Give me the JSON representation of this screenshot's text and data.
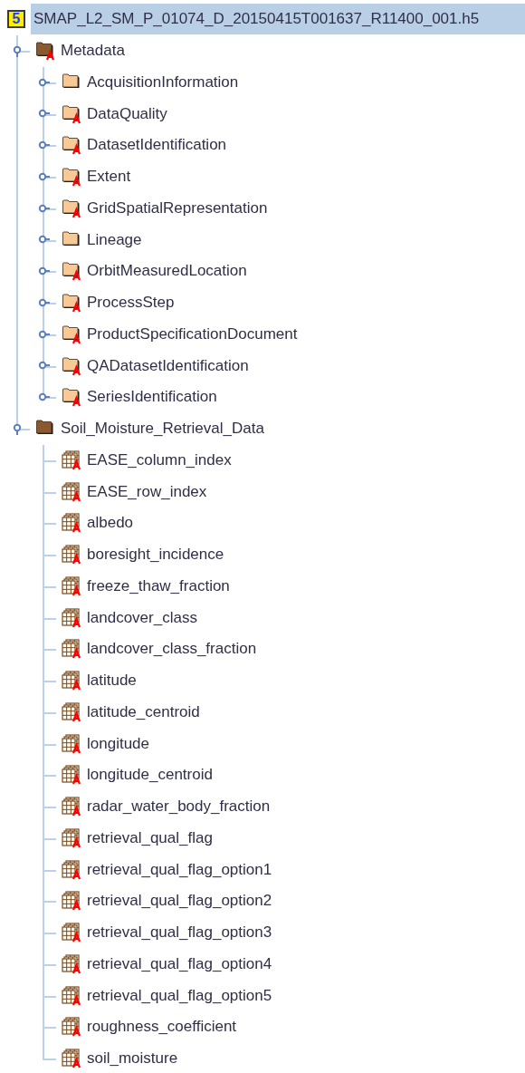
{
  "tree": {
    "label": "SMAP_L2_SM_P_01074_D_20150415T001637_R11400_001.h5",
    "file_icon_text": "5",
    "selected": true,
    "children": [
      {
        "kind": "group",
        "label": "Metadata",
        "expanded": true,
        "has_attributes": true,
        "children": [
          {
            "kind": "group",
            "label": "AcquisitionInformation",
            "expanded": false,
            "has_attributes": false
          },
          {
            "kind": "group",
            "label": "DataQuality",
            "expanded": false,
            "has_attributes": true
          },
          {
            "kind": "group",
            "label": "DatasetIdentification",
            "expanded": false,
            "has_attributes": true
          },
          {
            "kind": "group",
            "label": "Extent",
            "expanded": false,
            "has_attributes": true
          },
          {
            "kind": "group",
            "label": "GridSpatialRepresentation",
            "expanded": false,
            "has_attributes": true
          },
          {
            "kind": "group",
            "label": "Lineage",
            "expanded": false,
            "has_attributes": false
          },
          {
            "kind": "group",
            "label": "OrbitMeasuredLocation",
            "expanded": false,
            "has_attributes": true
          },
          {
            "kind": "group",
            "label": "ProcessStep",
            "expanded": false,
            "has_attributes": true
          },
          {
            "kind": "group",
            "label": "ProductSpecificationDocument",
            "expanded": false,
            "has_attributes": true
          },
          {
            "kind": "group",
            "label": "QADatasetIdentification",
            "expanded": false,
            "has_attributes": true
          },
          {
            "kind": "group",
            "label": "SeriesIdentification",
            "expanded": false,
            "has_attributes": true
          }
        ]
      },
      {
        "kind": "group",
        "label": "Soil_Moisture_Retrieval_Data",
        "expanded": true,
        "has_attributes": false,
        "children": [
          {
            "kind": "dataset",
            "label": "EASE_column_index",
            "has_attributes": true
          },
          {
            "kind": "dataset",
            "label": "EASE_row_index",
            "has_attributes": true
          },
          {
            "kind": "dataset",
            "label": "albedo",
            "has_attributes": true
          },
          {
            "kind": "dataset",
            "label": "boresight_incidence",
            "has_attributes": true
          },
          {
            "kind": "dataset",
            "label": "freeze_thaw_fraction",
            "has_attributes": true
          },
          {
            "kind": "dataset",
            "label": "landcover_class",
            "has_attributes": true
          },
          {
            "kind": "dataset",
            "label": "landcover_class_fraction",
            "has_attributes": true
          },
          {
            "kind": "dataset",
            "label": "latitude",
            "has_attributes": true
          },
          {
            "kind": "dataset",
            "label": "latitude_centroid",
            "has_attributes": true
          },
          {
            "kind": "dataset",
            "label": "longitude",
            "has_attributes": true
          },
          {
            "kind": "dataset",
            "label": "longitude_centroid",
            "has_attributes": true
          },
          {
            "kind": "dataset",
            "label": "radar_water_body_fraction",
            "has_attributes": true
          },
          {
            "kind": "dataset",
            "label": "retrieval_qual_flag",
            "has_attributes": true
          },
          {
            "kind": "dataset",
            "label": "retrieval_qual_flag_option1",
            "has_attributes": true
          },
          {
            "kind": "dataset",
            "label": "retrieval_qual_flag_option2",
            "has_attributes": true
          },
          {
            "kind": "dataset",
            "label": "retrieval_qual_flag_option3",
            "has_attributes": true
          },
          {
            "kind": "dataset",
            "label": "retrieval_qual_flag_option4",
            "has_attributes": true
          },
          {
            "kind": "dataset",
            "label": "retrieval_qual_flag_option5",
            "has_attributes": true
          },
          {
            "kind": "dataset",
            "label": "roughness_coefficient",
            "has_attributes": true
          },
          {
            "kind": "dataset",
            "label": "soil_moisture",
            "has_attributes": true
          }
        ]
      }
    ]
  }
}
